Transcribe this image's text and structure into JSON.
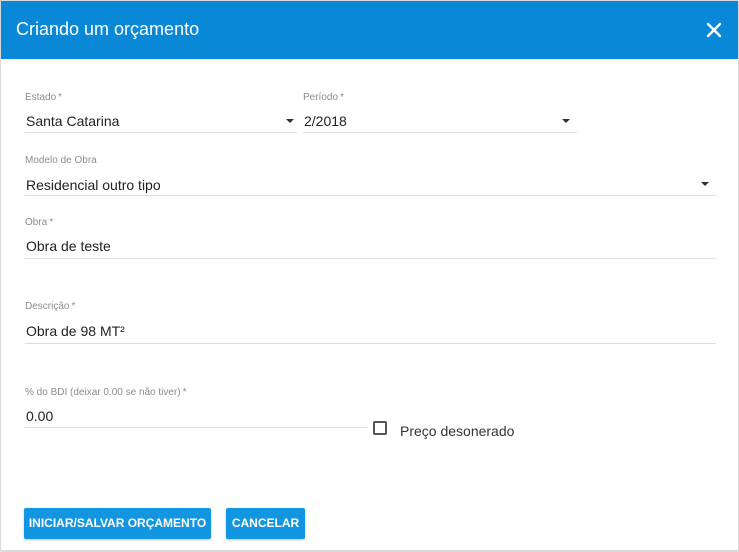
{
  "dialog": {
    "title": "Criando um orçamento",
    "close_icon": "close-icon"
  },
  "form": {
    "estado": {
      "label": "Estado",
      "required": "*",
      "value": "Santa Catarina"
    },
    "periodo": {
      "label": "Período",
      "required": "*",
      "value": "2/2018"
    },
    "modelo_obra": {
      "label": "Modelo de Obra",
      "value": "Residencial outro tipo"
    },
    "obra": {
      "label": "Obra",
      "required": "*",
      "value": "Obra de teste"
    },
    "descricao": {
      "label": "Descrição",
      "required": "*",
      "value": "Obra de 98 MT²"
    },
    "bdi": {
      "label": "% do BDI (deixar 0.00 se não tiver)",
      "required": "*",
      "value": "0.00"
    },
    "preco_desonerado": {
      "label": "Preço desonerado",
      "checked": false
    }
  },
  "buttons": {
    "save": "INICIAR/SALVAR ORÇAMENTO",
    "cancel": "CANCELAR"
  },
  "colors": {
    "header": "#0a88d8",
    "button": "#1396e2"
  }
}
